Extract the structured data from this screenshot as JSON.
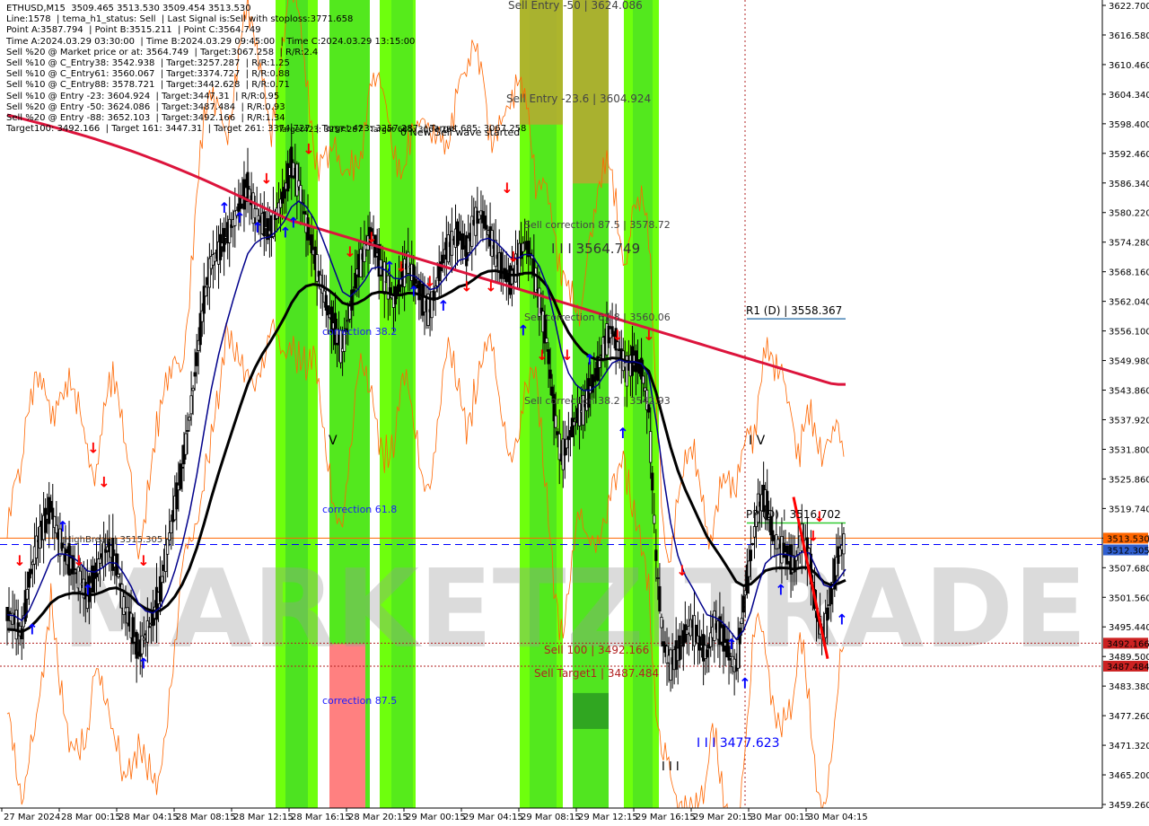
{
  "header": {
    "lines": [
      "ETHUSD,M15  3509.465 3513.530 3509.454 3513.530",
      "Line:1578  | tema_h1_status: Sell  | Last Signal is:Sell with stoploss:3771.658",
      "Point A:3587.794  | Point B:3515.211  | Point C:3564.749",
      "Time A:2024.03.29 03:30:00  | Time B:2024.03.29 09:45:00  | Time C:2024.03.29 13:15:00",
      "Sell %20 @ Market price or at: 3564.749  | Target:3067.258  | R/R:2.4",
      "Sell %10 @ C_Entry38: 3542.938  | Target:3257.287  | R/R:1.25",
      "Sell %10 @ C_Entry61: 3560.067  | Target:3374.727  | R/R:0.88",
      "Sell %10 @ C_Entry88: 3578.721  | Target:3442.628  | R/R:0.71",
      "Sell %10 @ Entry -23: 3604.924  | Target:3447.31  | R/R:0.95",
      "Sell %20 @ Entry -50: 3624.086  | Target:3487.484  | R/R:0.93",
      "Sell %20 @ Entry -88: 3652.103  | Target:3492.166  | R/R:1.34",
      "Target100: 3492.166  | Target 161: 3447.31  | Target 261: 3374.727  | Target 423: 3257.287  | Target 685: 3067.258"
    ]
  },
  "watermark": "MARKETZITRADE",
  "price_axis": {
    "ticks": [
      "3622.700",
      "3616.580",
      "3610.460",
      "3604.340",
      "3598.400",
      "3592.460",
      "3586.340",
      "3580.220",
      "3574.280",
      "3568.160",
      "3562.040",
      "3556.100",
      "3549.980",
      "3543.860",
      "3537.920",
      "3531.800",
      "3525.860",
      "3519.740",
      "3513.620",
      "3507.680",
      "3501.560",
      "3495.440",
      "3489.500",
      "3483.380",
      "3477.260",
      "3471.320",
      "3465.200",
      "3459.260"
    ],
    "current_price_label": "3512.305",
    "top_price_label": "3513.530",
    "sell100_label": "3492.166",
    "target1_label": "3487.484"
  },
  "time_axis": {
    "ticks": [
      "27 Mar 2024",
      "28 Mar 00:15",
      "28 Mar 04:15",
      "28 Mar 08:15",
      "28 Mar 12:15",
      "28 Mar 16:15",
      "28 Mar 20:15",
      "29 Mar 00:15",
      "29 Mar 04:15",
      "29 Mar 08:15",
      "29 Mar 12:15",
      "29 Mar 16:15",
      "29 Mar 20:15",
      "30 Mar 00:15",
      "30 Mar 04:15"
    ]
  },
  "annotations": {
    "sell_entry_50": "Sell Entry -50 | 3624.086",
    "sell_entry_23": "Sell Entry -23.6 | 3604.924",
    "new_sell_wave": "0 New Sell wave started",
    "target_423": "Target423: 3257.287",
    "target_685": "Target 685: 3067.258",
    "sell_corr_875": "Sell correction 87.5 | 3578.72",
    "sell_corr_618": "Sell correction 61.8 | 3560.06",
    "sell_corr_382": "Sell correction 38.2 | 3542.93",
    "wave_iii_c": "I I I 3564.749",
    "r1": "R1 (D) | 3558.367",
    "pp": "PP (D) | 3516.702",
    "sell_100": "Sell 100 | 3492.166",
    "sell_target1": "Sell Target1 | 3487.484",
    "wave_iii_low": "I I I 3477.623",
    "wave_iii_bottom": "I I I",
    "wave_iv": "I V",
    "wave_v": "V",
    "correction_382": "correction 38.2",
    "correction_618": "correction 61.8",
    "correction_875": "correction 87.5",
    "high_break": "HighBreak | 3515.305"
  },
  "colors": {
    "bright_green": "#66ff00",
    "mid_green": "#33cc33",
    "salmon": "#ff8080",
    "olive": "#b8a832",
    "red_line": "#dc143c",
    "navy_line": "#00008b",
    "black_line": "#000000",
    "orange": "#ff6600",
    "blue_line": "#0000ff",
    "r1_blue": "#4682b4",
    "pp_green": "#33cc33",
    "sell_red": "#b22222",
    "current_bg": "#2f5fd0"
  },
  "chart_data": {
    "type": "candlestick",
    "symbol": "ETHUSD",
    "timeframe": "M15",
    "last_ohlc": {
      "open": 3509.465,
      "high": 3513.53,
      "low": 3509.454,
      "close": 3513.53
    },
    "ylim": [
      3459.26,
      3622.7
    ],
    "levels": [
      {
        "name": "Sell Entry -50",
        "value": 3624.086
      },
      {
        "name": "Sell Entry -23.6",
        "value": 3604.924
      },
      {
        "name": "R1 (D)",
        "value": 3558.367
      },
      {
        "name": "PP (D)",
        "value": 3516.702
      },
      {
        "name": "HighBreak",
        "value": 3515.305
      },
      {
        "name": "current",
        "value": 3512.305
      },
      {
        "name": "Sell 100",
        "value": 3492.166
      },
      {
        "name": "Sell Target1",
        "value": 3487.484
      },
      {
        "name": "III",
        "value": 3477.623
      }
    ],
    "close_path": [
      3498,
      3497,
      3494,
      3505,
      3512,
      3516,
      3520,
      3514,
      3510,
      3508,
      3505,
      3502,
      3506,
      3510,
      3512,
      3508,
      3500,
      3496,
      3490,
      3494,
      3497,
      3503,
      3512,
      3520,
      3528,
      3538,
      3550,
      3562,
      3570,
      3572,
      3575,
      3578,
      3582,
      3585,
      3580,
      3578,
      3576,
      3580,
      3584,
      3590,
      3586,
      3578,
      3572,
      3566,
      3560,
      3556,
      3552,
      3560,
      3568,
      3572,
      3576,
      3570,
      3566,
      3562,
      3566,
      3570,
      3566,
      3562,
      3560,
      3566,
      3572,
      3574,
      3576,
      3572,
      3578,
      3580,
      3576,
      3572,
      3568,
      3566,
      3570,
      3574,
      3571,
      3562,
      3554,
      3540,
      3530,
      3534,
      3538,
      3540,
      3544,
      3548,
      3554,
      3556,
      3552,
      3548,
      3550,
      3548,
      3540,
      3510,
      3492,
      3488,
      3490,
      3494,
      3496,
      3492,
      3490,
      3496,
      3494,
      3490,
      3487,
      3500,
      3510,
      3520,
      3522,
      3514,
      3512,
      3510,
      3508,
      3514,
      3510,
      3498,
      3494,
      3502,
      3510,
      3513.5
    ]
  }
}
